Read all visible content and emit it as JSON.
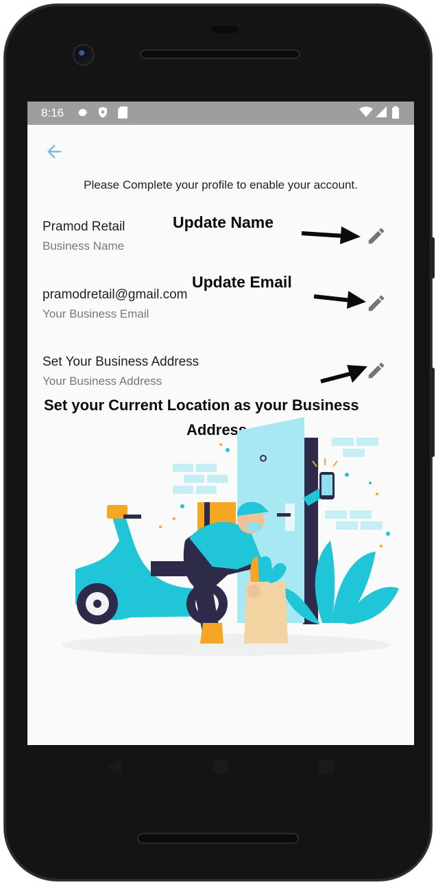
{
  "status_bar": {
    "time": "8:16",
    "icons": [
      "settings-icon",
      "shield-icon",
      "sd-card-icon",
      "wifi-icon",
      "signal-icon",
      "battery-icon"
    ]
  },
  "header": {
    "back_icon": "arrow-back-icon",
    "intro_text": "Please Complete your profile to enable your account."
  },
  "fields": [
    {
      "value": "Pramod Retail",
      "label": "Business Name",
      "edit_icon": "pencil-icon"
    },
    {
      "value": "pramodretail@gmail.com",
      "label": "Your Business Email",
      "edit_icon": "pencil-icon"
    },
    {
      "value": "Set Your Business Address",
      "label": "Your Business Address",
      "edit_icon": "pencil-icon"
    }
  ],
  "annotations": {
    "update_name": "Update Name",
    "update_email": "Update Email",
    "set_location_line1": "Set your Current Location as your Business",
    "set_location_line2": "Address"
  },
  "navigation": {
    "buttons": [
      "back-triangle-icon",
      "home-circle-icon",
      "overview-square-icon"
    ]
  },
  "colors": {
    "accent": "#7fb8e6",
    "status_bar": "#9e9e9e",
    "edit_icon": "#757575",
    "illustration_teal": "#20c5d8",
    "illustration_orange": "#f5a623"
  }
}
